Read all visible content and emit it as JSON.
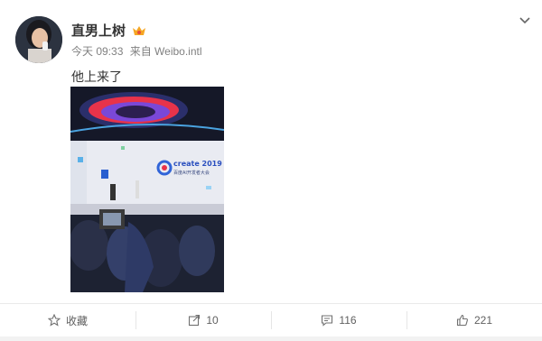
{
  "post": {
    "username": "直男上树",
    "timestamp": "今天 09:33",
    "source": "来自 Weibo.intl",
    "text": "他上来了",
    "image_alt": "stage photo",
    "image_caption_text": "create 2019",
    "image_subcaption_text": "百度AI开发者大会"
  },
  "actions": {
    "favorite_label": "收藏",
    "repost_count": "10",
    "comment_count": "116",
    "like_count": "221"
  },
  "icons": {
    "vip": "vip-icon",
    "menu": "chevron-down-icon",
    "favorite": "star-icon",
    "repost": "repost-icon",
    "comment": "comment-icon",
    "like": "thumbs-up-icon"
  },
  "colors": {
    "text_primary": "#333333",
    "text_meta": "#808080",
    "action_text": "#606060",
    "divider": "#eaeaea"
  }
}
